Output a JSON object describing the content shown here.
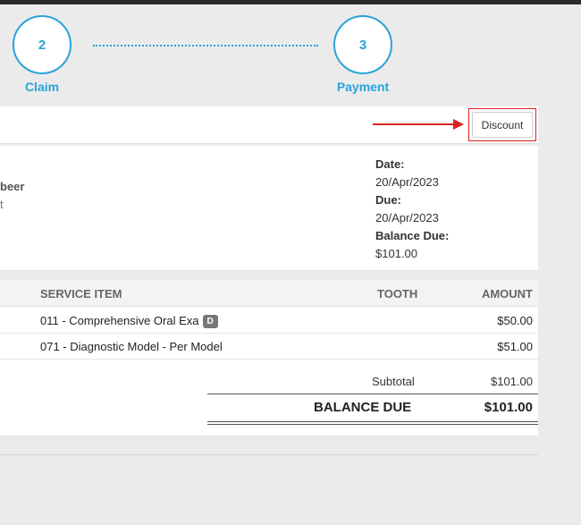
{
  "steps": [
    {
      "number": "2",
      "label": "Claim"
    },
    {
      "number": "3",
      "label": "Payment"
    }
  ],
  "toolbar": {
    "discount_label": "Discount"
  },
  "patient": {
    "name_partial": "beer",
    "sub_partial": "t"
  },
  "invoice_meta": {
    "date_label": "Date:",
    "date_value": "20/Apr/2023",
    "due_label": "Due:",
    "due_value": "20/Apr/2023",
    "balance_due_label": "Balance Due:",
    "balance_due_value": "$101.00"
  },
  "table": {
    "headers": {
      "service_item": "SERVICE ITEM",
      "tooth": "TOOTH",
      "amount": "AMOUNT"
    },
    "rows": [
      {
        "description": "011 - Comprehensive Oral Exa",
        "badge": "D",
        "tooth": "",
        "amount": "$50.00"
      },
      {
        "description": "071 - Diagnostic Model - Per Model",
        "badge": "",
        "tooth": "",
        "amount": "$51.00"
      }
    ]
  },
  "totals": {
    "subtotal_label": "Subtotal",
    "subtotal_value": "$101.00",
    "balance_due_label": "BALANCE DUE",
    "balance_due_value": "$101.00"
  },
  "colors": {
    "accent": "#29a3d8",
    "highlight": "#dd2222"
  }
}
